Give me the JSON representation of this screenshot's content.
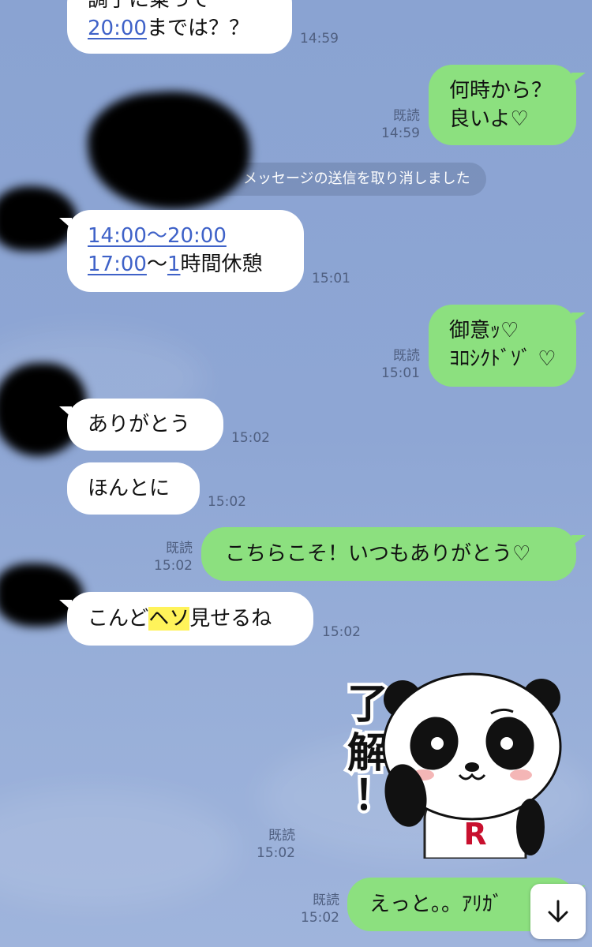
{
  "messages": [
    {
      "id": "m1",
      "line1": "調子に乗って",
      "link": "20:00",
      "rest": "までは？？",
      "time": "14:59"
    },
    {
      "id": "m2",
      "line1": "何時から？",
      "line2": "良いよ♡",
      "read": "既読",
      "time": "14:59"
    },
    {
      "id": "sys",
      "text": "メッセージの送信を取り消しました"
    },
    {
      "id": "m3",
      "l1a": "14:00",
      "l1b": "～",
      "l1c": "20:00",
      "l2a": "17:00",
      "l2b": "～",
      "l2c": "1",
      "l2d": "時間休憩",
      "time": "15:01"
    },
    {
      "id": "m4",
      "line1": "御意ｯ♡",
      "line2": "ﾖﾛｼｸﾄﾞｿﾞ ♡",
      "read": "既読",
      "time": "15:01"
    },
    {
      "id": "m5",
      "text": "ありがとう",
      "time": "15:02"
    },
    {
      "id": "m6",
      "text": "ほんとに",
      "time": "15:02"
    },
    {
      "id": "m7",
      "text": "こちらこそ！いつもありがとう♡",
      "read": "既読",
      "time": "15:02"
    },
    {
      "id": "m8",
      "pre": "こんど",
      "hl": "ヘソ",
      "post": "見せるね",
      "time": "15:02"
    },
    {
      "id": "m9",
      "sticker_text": "了解！",
      "sticker_logo": "R",
      "read": "既読",
      "time": "15:02"
    },
    {
      "id": "m10",
      "text": "えっと。。ｱﾘｶﾞ",
      "read": "既読",
      "time": "15:02"
    }
  ],
  "icons": {
    "scroll_down": "arrow-down-icon",
    "sticker": "panda-sticker-icon"
  },
  "colors": {
    "background": "#8ea6d4",
    "incoming_bubble": "#ffffff",
    "outgoing_bubble": "#8ce07f",
    "link": "#3f62c8",
    "highlight": "#fff35a"
  }
}
